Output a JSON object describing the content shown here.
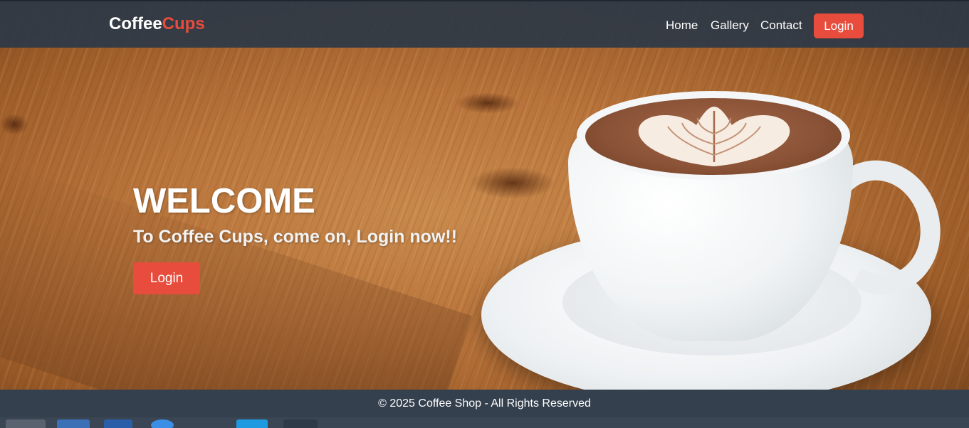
{
  "brand": {
    "part1": "Coffee",
    "part2": "Cups"
  },
  "nav": {
    "links": [
      "Home",
      "Gallery",
      "Contact"
    ],
    "login_label": "Login"
  },
  "hero": {
    "title": "WELCOME",
    "subtitle": "To Coffee Cups, come on, Login now!!",
    "button_label": "Login",
    "background_image": "coffee-cup-on-wooden-table"
  },
  "footer": {
    "text": "© 2025 Coffee Shop - All Rights Reserved"
  },
  "taskbar": {
    "icons": [
      "folder-icon",
      "app-icon",
      "browser-icon",
      "editor-icon",
      "terminal-icon",
      "files-icon"
    ]
  },
  "colors": {
    "accent": "#e74c3c",
    "navbar": "#2c3846",
    "footer": "#34404d"
  }
}
